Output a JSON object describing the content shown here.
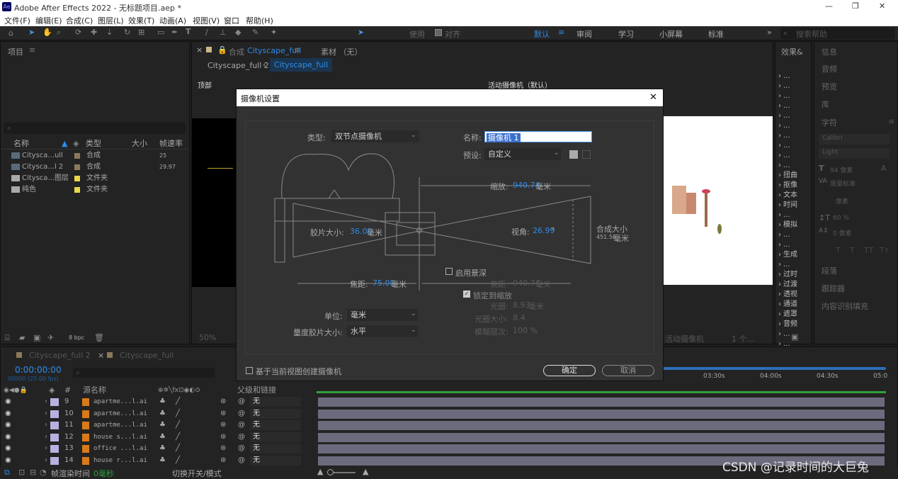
{
  "app": {
    "icon": "Ae",
    "title": "Adobe After Effects 2022 - 无标题项目.aep *"
  },
  "window_controls": [
    "—",
    "❐",
    "✕"
  ],
  "menu": [
    "文件(F)",
    "编辑(E)",
    "合成(C)",
    "图层(L)",
    "效果(T)",
    "动画(A)",
    "视图(V)",
    "窗口",
    "帮助(H)"
  ],
  "toolbar": {
    "workspaces": [
      "默认",
      "审阅",
      "学习",
      "小屏幕",
      "标准"
    ],
    "overflow": "»",
    "search_placeholder": "搜索帮助",
    "align": "对齐",
    "use": "使用"
  },
  "project": {
    "title": "项目",
    "menu": "≡",
    "cols": [
      "名称",
      "类型",
      "大小",
      "帧速率"
    ],
    "items": [
      {
        "name": "Cityscа...ull",
        "type": "合成",
        "size": "",
        "fps": "25",
        "color": "#8a7a5a"
      },
      {
        "name": "Cityscа...l 2",
        "type": "合成",
        "size": "",
        "fps": "29.97",
        "color": "#8a7a5a"
      },
      {
        "name": "Cityscа...图层",
        "type": "文件夹",
        "size": "",
        "fps": "",
        "color": "#e8d84a"
      },
      {
        "name": "纯色",
        "type": "文件夹",
        "size": "",
        "fps": "",
        "color": "#e8d84a"
      }
    ],
    "bpc": "8 bpc"
  },
  "comp": {
    "tab": "合成 Cityscape_full",
    "tab_prefix": "合成",
    "tab_name": "Cityscape_full",
    "tab2": "素材 （无）",
    "crumb1": "Cityscape_full 2",
    "crumb2": "Cityscape_full",
    "view_left": "顶部",
    "view_right": "活动摄像机（默认）",
    "zoom": "50%",
    "bottom_cam": "活动摄像机",
    "bottom_views": "1 个..."
  },
  "effects": {
    "title": "效果&",
    "items": [
      "...",
      "...",
      "...",
      "...",
      "...",
      "...",
      "...",
      "...",
      "...",
      "...",
      "扭曲",
      "抠像",
      "文本",
      "时间",
      "...",
      "模拟",
      "...",
      "...",
      "生成",
      "...",
      "过时",
      "过渡",
      "透视",
      "通道",
      "遮罩",
      "音频",
      "...",
      "..."
    ]
  },
  "right": {
    "items": [
      "信息",
      "音频",
      "预览",
      "库",
      "字符",
      "段落",
      "跟踪器",
      "内容识别填充"
    ],
    "font": "Calibri",
    "style": "Light",
    "size": "94 像素",
    "leading": "自动",
    "tracking": "度量标准",
    "fill": "像素",
    "scale": "60 %",
    "baseline": "0 像素",
    "char_menu": "≡",
    "text_formats": [
      "T",
      "T",
      "TT",
      "Tт"
    ]
  },
  "timeline": {
    "tab1": "Cityscape_full 2",
    "tab2": "Cityscape_full",
    "time": "0:00:00:00",
    "fps": "00000 (25.00 fps)",
    "search_placeholder": "",
    "col_num": "#",
    "col_source": "源名称",
    "col_parent": "父级和链接",
    "ticks": [
      "03:30s",
      "04:00s",
      "04:30s",
      "05:0"
    ],
    "layers": [
      {
        "num": "9",
        "name": "apartme...l.ai",
        "parent": "无"
      },
      {
        "num": "10",
        "name": "apartme...l.ai",
        "parent": "无"
      },
      {
        "num": "11",
        "name": "apartme...l.ai",
        "parent": "无"
      },
      {
        "num": "12",
        "name": "house s...l.ai",
        "parent": "无"
      },
      {
        "num": "13",
        "name": "office ...l.ai",
        "parent": "无"
      },
      {
        "num": "14",
        "name": "house r...l.ai",
        "parent": "无"
      }
    ],
    "footer_render": "帧渲染时间",
    "footer_ms": "0毫秒",
    "footer_switch": "切换开关/模式"
  },
  "dialog": {
    "title": "摄像机设置",
    "close": "✕",
    "type_label": "类型:",
    "type_value": "双节点摄像机",
    "name_label": "名称:",
    "name_value": "摄像机 1",
    "preset_label": "预设:",
    "preset_value": "自定义",
    "zoom_label": "缩放:",
    "zoom_value": "940.74",
    "unit_mm": "毫米",
    "film_label": "胶片大小:",
    "film_value": "36.00",
    "fov_label": "视角:",
    "fov_value": "26.99",
    "deg": "°",
    "comp_label": "合成大小",
    "comp_value": "451.56",
    "focal_label": "焦距:",
    "focal_value": "75.00",
    "dof_label": "启用景深",
    "focus_label": "焦距:",
    "focus_value": "940.74",
    "lock_label": "锁定到缩放",
    "aperture_label": "光圈:",
    "aperture_value": "8.93",
    "fstop_label": "光圈大小:",
    "fstop_value": "8.4",
    "blur_label": "模糊层次:",
    "blur_value": "100 %",
    "unit_label": "单位:",
    "unit_value": "毫米",
    "measure_label": "量度胶片大小:",
    "measure_value": "水平",
    "based_label": "基于当前视图创建摄像机",
    "ok": "确定",
    "cancel": "取消"
  },
  "watermark": "CSDN @记录时间的大巨兔"
}
